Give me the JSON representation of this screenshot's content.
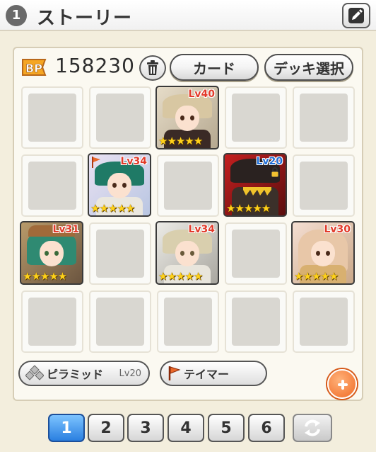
{
  "header": {
    "number": "1",
    "title": "ストーリー"
  },
  "deck": {
    "bp_label": "BP",
    "bp_value": "158230",
    "card_button": "カード",
    "deck_select_button": "デッキ選択"
  },
  "units": [
    {
      "level": "Lv40",
      "stars": "★★★★★"
    },
    {
      "level": "Lv34",
      "stars": "★★★★★"
    },
    {
      "level": "Lv20",
      "stars": "★★★★★"
    },
    {
      "level": "Lv31",
      "stars": "★★★★★"
    },
    {
      "level": "Lv34",
      "stars": "★★★★★"
    },
    {
      "level": "Lv30",
      "stars": "★★★★★"
    }
  ],
  "skills": {
    "pyramid_label": "ピラミッド",
    "pyramid_level": "Lv20",
    "tamer_label": "テイマー"
  },
  "pages": [
    "1",
    "2",
    "3",
    "4",
    "5",
    "6"
  ],
  "active_page": "1",
  "colors": {
    "active_tab": "#2a7fe0",
    "add_button": "#f06a25",
    "level_text": "#e23a2a"
  }
}
